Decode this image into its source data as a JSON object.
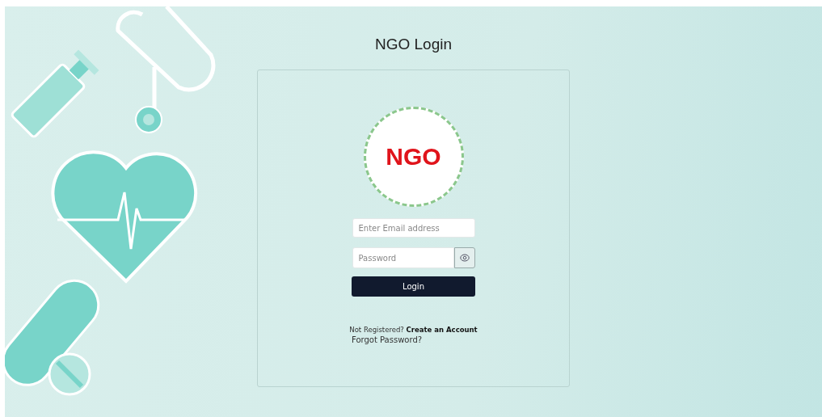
{
  "title": "NGO Login",
  "logo": {
    "text": "NGO"
  },
  "form": {
    "email": {
      "placeholder": "Enter Email address"
    },
    "password": {
      "placeholder": "Password"
    },
    "login_button": "Login"
  },
  "footer": {
    "prompt": "Not Registered?",
    "link": "Create an Account",
    "forgot": "Forgot Password?"
  }
}
